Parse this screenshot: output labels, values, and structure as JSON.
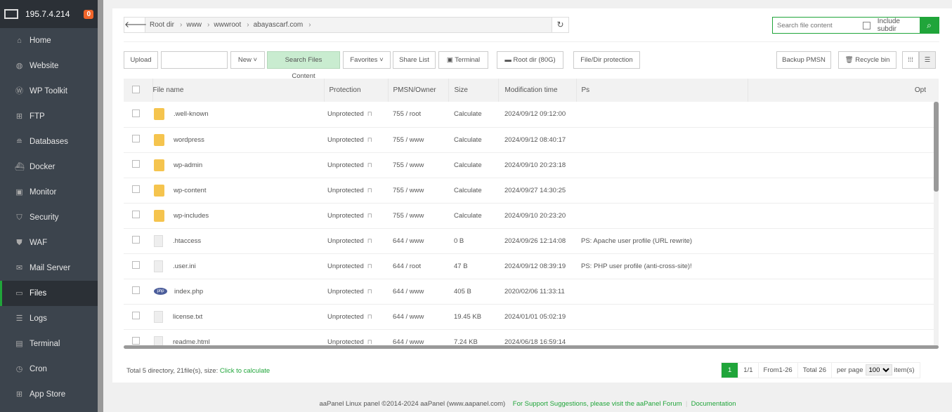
{
  "sidebar": {
    "host": "195.7.4.214",
    "badge": "0",
    "items": [
      {
        "label": "Home",
        "icon": "⌂"
      },
      {
        "label": "Website",
        "icon": "◍"
      },
      {
        "label": "WP Toolkit",
        "icon": "Ⓦ"
      },
      {
        "label": "FTP",
        "icon": "⊞"
      },
      {
        "label": "Databases",
        "icon": "≘"
      },
      {
        "label": "Docker",
        "icon": "⛴"
      },
      {
        "label": "Monitor",
        "icon": "▣"
      },
      {
        "label": "Security",
        "icon": "⛉"
      },
      {
        "label": "WAF",
        "icon": "⛊"
      },
      {
        "label": "Mail Server",
        "icon": "✉"
      },
      {
        "label": "Files",
        "icon": "▭"
      },
      {
        "label": "Logs",
        "icon": "☰"
      },
      {
        "label": "Terminal",
        "icon": "▤"
      },
      {
        "label": "Cron",
        "icon": "◷"
      },
      {
        "label": "App Store",
        "icon": "⊞"
      }
    ]
  },
  "breadcrumb": [
    "Root dir",
    "www",
    "wwwroot",
    "abayascarf.com"
  ],
  "search": {
    "placeholder": "Search file content",
    "include_subdir": "Include subdir"
  },
  "toolbar": {
    "upload": "Upload",
    "new": "New",
    "search_files": "Search Files Content",
    "favorites": "Favorites",
    "share": "Share List",
    "terminal": "Terminal",
    "rootdir": "Root dir (80G)",
    "protection": "File/Dir protection",
    "backup": "Backup PMSN",
    "recycle": "Recycle bin"
  },
  "table": {
    "headers": [
      "File name",
      "Protection",
      "PMSN/Owner",
      "Size",
      "Modification time",
      "Ps",
      "Opt"
    ],
    "rows": [
      {
        "name": ".well-known",
        "type": "folder",
        "protection": "Unprotected",
        "pmsn": "755 / root",
        "size": "Calculate",
        "mtime": "2024/09/12 09:12:00",
        "ps": ""
      },
      {
        "name": "wordpress",
        "type": "folder",
        "protection": "Unprotected",
        "pmsn": "755 / www",
        "size": "Calculate",
        "mtime": "2024/09/12 08:40:17",
        "ps": ""
      },
      {
        "name": "wp-admin",
        "type": "folder",
        "protection": "Unprotected",
        "pmsn": "755 / www",
        "size": "Calculate",
        "mtime": "2024/09/10 20:23:18",
        "ps": ""
      },
      {
        "name": "wp-content",
        "type": "folder",
        "protection": "Unprotected",
        "pmsn": "755 / www",
        "size": "Calculate",
        "mtime": "2024/09/27 14:30:25",
        "ps": ""
      },
      {
        "name": "wp-includes",
        "type": "folder",
        "protection": "Unprotected",
        "pmsn": "755 / www",
        "size": "Calculate",
        "mtime": "2024/09/10 20:23:20",
        "ps": ""
      },
      {
        "name": ".htaccess",
        "type": "file",
        "protection": "Unprotected",
        "pmsn": "644 / www",
        "size": "0 B",
        "mtime": "2024/09/26 12:14:08",
        "ps": "PS: Apache user profile (URL rewrite)"
      },
      {
        "name": ".user.ini",
        "type": "file",
        "protection": "Unprotected",
        "pmsn": "644 / root",
        "size": "47 B",
        "mtime": "2024/09/12 08:39:19",
        "ps": "PS: PHP user profile (anti-cross-site)!"
      },
      {
        "name": "index.php",
        "type": "php",
        "protection": "Unprotected",
        "pmsn": "644 / www",
        "size": "405 B",
        "mtime": "2020/02/06 11:33:11",
        "ps": ""
      },
      {
        "name": "license.txt",
        "type": "file",
        "protection": "Unprotected",
        "pmsn": "644 / www",
        "size": "19.45 KB",
        "mtime": "2024/01/01 05:02:19",
        "ps": ""
      },
      {
        "name": "readme.html",
        "type": "file",
        "protection": "Unprotected",
        "pmsn": "644 / www",
        "size": "7.24 KB",
        "mtime": "2024/06/18 16:59:14",
        "ps": ""
      }
    ]
  },
  "summary": {
    "text": "Total 5 directory, 21file(s), size:",
    "link": "Click to calculate"
  },
  "pager": {
    "current": "1",
    "pages": "1/1",
    "range": "From1-26",
    "total": "Total 26",
    "per_page_label": "per page",
    "per_page": "100",
    "items": "item(s)"
  },
  "footer": {
    "copyright": "aaPanel Linux panel ©2014-2024 aaPanel (www.aapanel.com)",
    "support": "For Support Suggestions, please visit the aaPanel Forum",
    "docs": "Documentation"
  }
}
